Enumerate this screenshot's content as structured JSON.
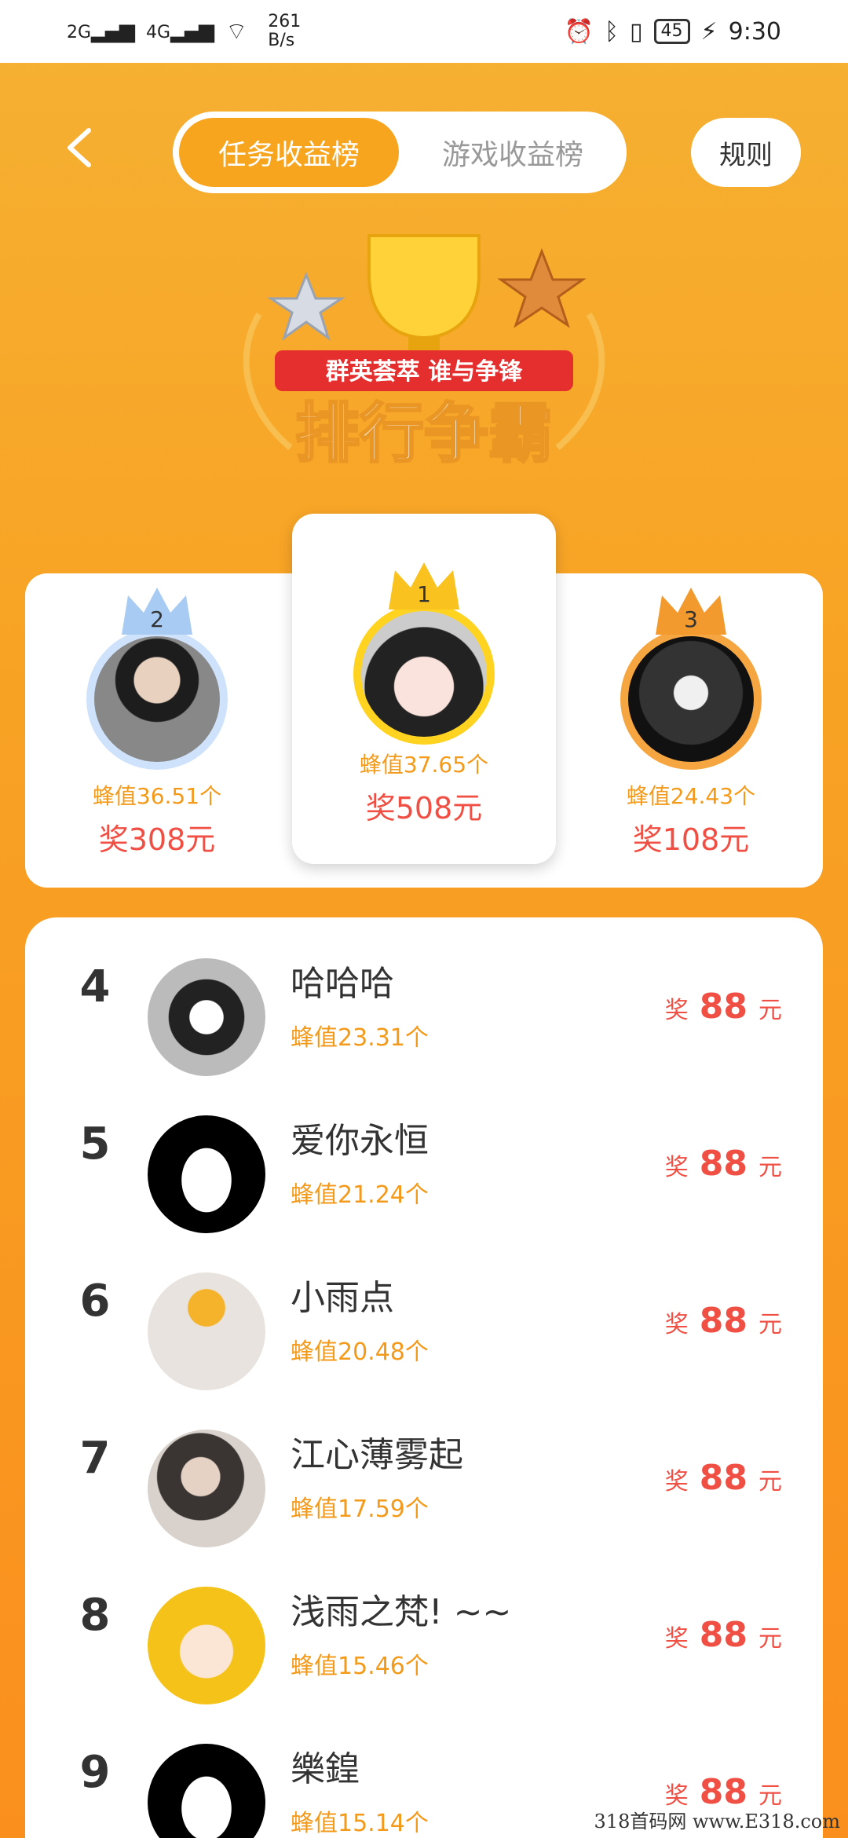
{
  "status": {
    "signal1": "2G",
    "signal2": "4G",
    "net_speed": "261",
    "net_unit": "B/s",
    "battery": "45",
    "time": "9:30"
  },
  "tabs": {
    "active": "任务收益榜",
    "inactive": "游戏收益榜"
  },
  "rules_label": "规则",
  "banner": {
    "ribbon": "群英荟萃 谁与争锋",
    "title": "排行争霸"
  },
  "top3": [
    {
      "rank": "2",
      "value": "蜂值36.51个",
      "prize": "奖308元",
      "ring": "#cfe2fb",
      "crown": "#a8cbf4"
    },
    {
      "rank": "1",
      "value": "蜂值37.65个",
      "prize": "奖508元",
      "ring": "#ffd320",
      "crown": "#f9c21e"
    },
    {
      "rank": "3",
      "value": "蜂值24.43个",
      "prize": "奖108元",
      "ring": "#f5a640",
      "crown": "#f39a2e"
    }
  ],
  "list": [
    {
      "rank": "4",
      "name": "哈哈哈",
      "value": "蜂值23.31个",
      "prize_pre": "奖",
      "prize": "88",
      "prize_unit": "元"
    },
    {
      "rank": "5",
      "name": "爱你永恒",
      "value": "蜂值21.24个",
      "prize_pre": "奖",
      "prize": "88",
      "prize_unit": "元"
    },
    {
      "rank": "6",
      "name": "小雨点",
      "value": "蜂值20.48个",
      "prize_pre": "奖",
      "prize": "88",
      "prize_unit": "元"
    },
    {
      "rank": "7",
      "name": "江心薄雾起",
      "value": "蜂值17.59个",
      "prize_pre": "奖",
      "prize": "88",
      "prize_unit": "元"
    },
    {
      "rank": "8",
      "name": "浅雨之梵! ~~",
      "value": "蜂值15.46个",
      "prize_pre": "奖",
      "prize": "88",
      "prize_unit": "元"
    },
    {
      "rank": "9",
      "name": "樂鍠",
      "value": "蜂值15.14个",
      "prize_pre": "奖",
      "prize": "88",
      "prize_unit": "元"
    }
  ],
  "watermark": "318首码网 www.E318.com"
}
